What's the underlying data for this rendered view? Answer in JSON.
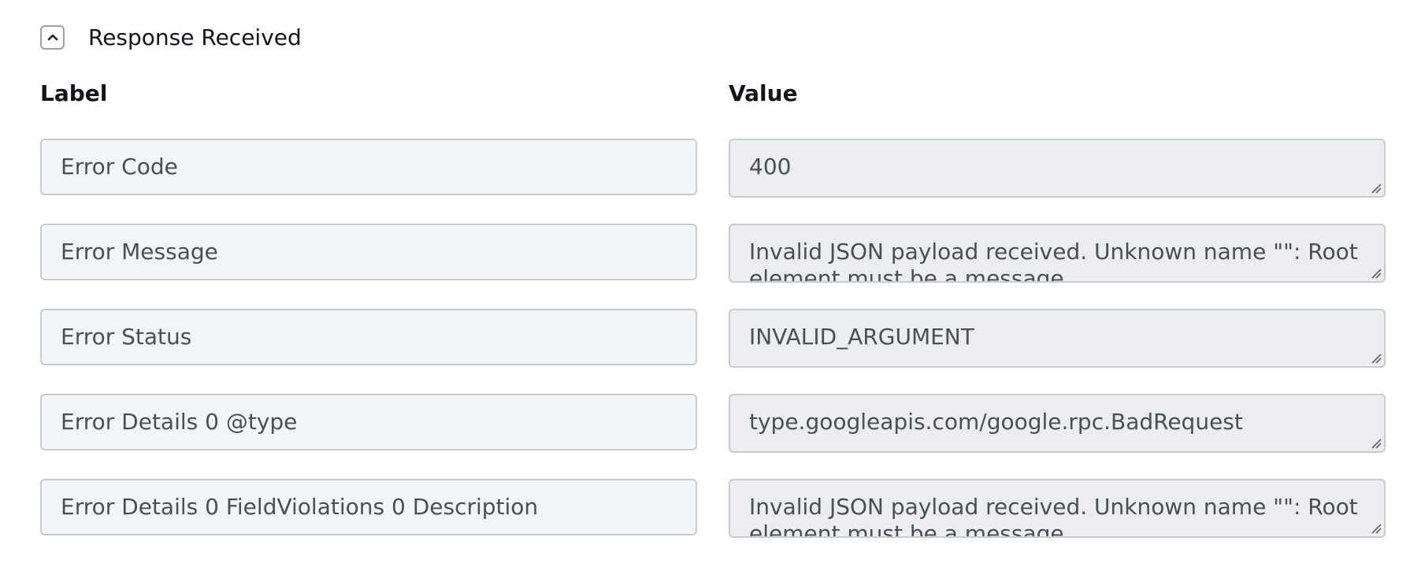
{
  "section": {
    "title": "Response Received",
    "toggle_icon": "chevron-up-icon"
  },
  "columns": {
    "label": "Label",
    "value": "Value"
  },
  "rows": [
    {
      "label": "Error Code",
      "value": "400"
    },
    {
      "label": "Error Message",
      "value": "Invalid JSON payload received. Unknown name \"\": Root element must be a message."
    },
    {
      "label": "Error Status",
      "value": "INVALID_ARGUMENT"
    },
    {
      "label": "Error Details 0 @type",
      "value": "type.googleapis.com/google.rpc.BadRequest"
    },
    {
      "label": "Error Details 0 FieldViolations 0 Description",
      "value": "Invalid JSON payload received. Unknown name \"\": Root element must be a message."
    }
  ],
  "colors": {
    "label_field_bg": "#f2f5f8",
    "value_field_bg": "#ebedf0",
    "border": "#c8ccd1"
  }
}
